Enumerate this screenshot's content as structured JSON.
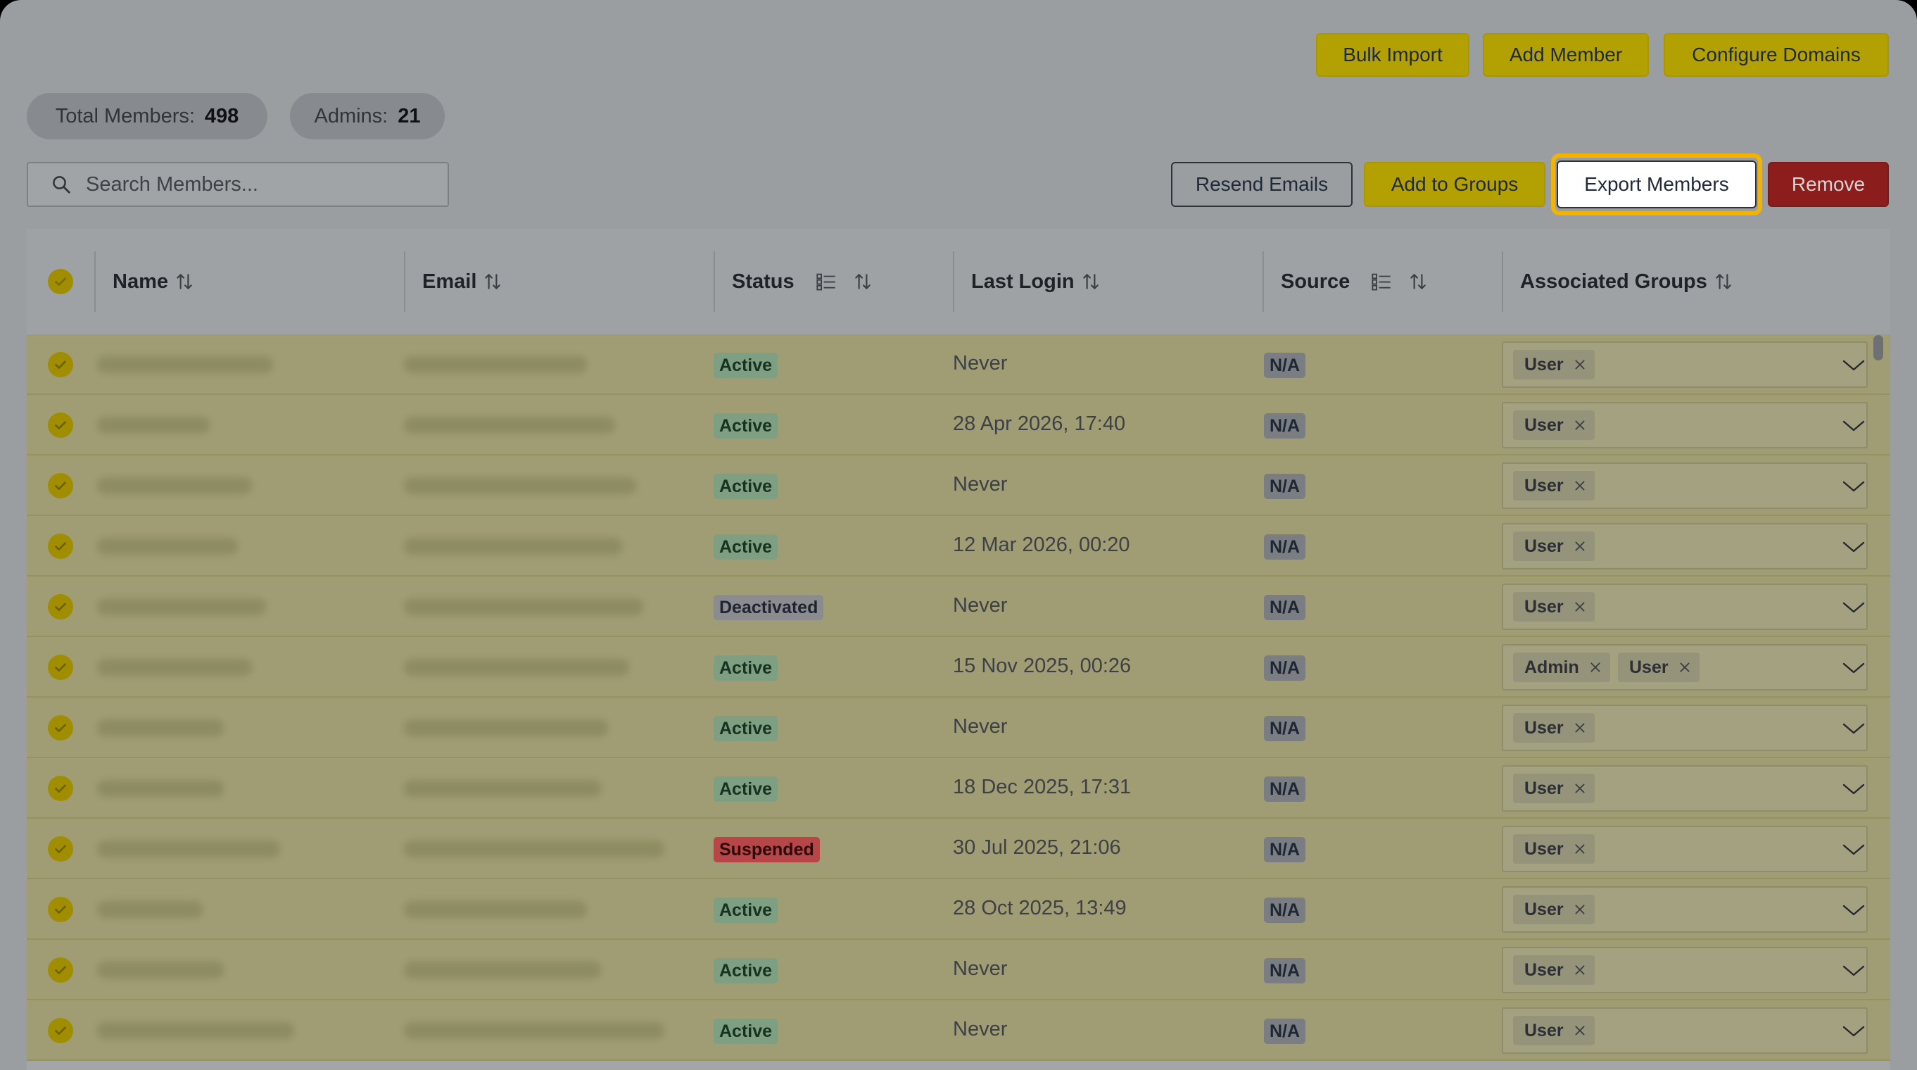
{
  "toolbar": {
    "bulk_import": "Bulk Import",
    "add_member": "Add Member",
    "configure_domains": "Configure Domains"
  },
  "stats": {
    "total_label": "Total Members:",
    "total_value": "498",
    "admins_label": "Admins:",
    "admins_value": "21"
  },
  "search": {
    "placeholder": "Search Members..."
  },
  "actions": {
    "resend_emails": "Resend Emails",
    "add_to_groups": "Add to Groups",
    "export_members": "Export Members",
    "remove": "Remove"
  },
  "table": {
    "headers": {
      "name": "Name",
      "email": "Email",
      "status": "Status",
      "last_login": "Last Login",
      "source": "Source",
      "groups": "Associated Groups"
    },
    "rows": [
      {
        "status": "Active",
        "last_login": "Never",
        "source": "N/A",
        "groups": [
          "User"
        ]
      },
      {
        "status": "Active",
        "last_login": "28 Apr 2026, 17:40",
        "source": "N/A",
        "groups": [
          "User"
        ]
      },
      {
        "status": "Active",
        "last_login": "Never",
        "source": "N/A",
        "groups": [
          "User"
        ]
      },
      {
        "status": "Active",
        "last_login": "12 Mar 2026, 00:20",
        "source": "N/A",
        "groups": [
          "User"
        ]
      },
      {
        "status": "Deactivated",
        "last_login": "Never",
        "source": "N/A",
        "groups": [
          "User"
        ]
      },
      {
        "status": "Active",
        "last_login": "15 Nov 2025, 00:26",
        "source": "N/A",
        "groups": [
          "Admin",
          "User"
        ]
      },
      {
        "status": "Active",
        "last_login": "Never",
        "source": "N/A",
        "groups": [
          "User"
        ]
      },
      {
        "status": "Active",
        "last_login": "18 Dec 2025, 17:31",
        "source": "N/A",
        "groups": [
          "User"
        ]
      },
      {
        "status": "Suspended",
        "last_login": "30 Jul 2025, 21:06",
        "source": "N/A",
        "groups": [
          "User"
        ]
      },
      {
        "status": "Active",
        "last_login": "28 Oct 2025, 13:49",
        "source": "N/A",
        "groups": [
          "User"
        ]
      },
      {
        "status": "Active",
        "last_login": "Never",
        "source": "N/A",
        "groups": [
          "User"
        ]
      },
      {
        "status": "Active",
        "last_login": "Never",
        "source": "N/A",
        "groups": [
          "User"
        ]
      }
    ]
  },
  "colors": {
    "accent_yellow": "#b3a104",
    "focus_ring": "#f2b400",
    "danger": "#8c1d1d",
    "selected_row": "#a09c73"
  },
  "icons": {
    "search": "search-icon",
    "sort": "sort-icon",
    "filter": "filter-list-icon",
    "check": "check-circle-icon",
    "remove_chip": "close-icon",
    "dropdown": "chevron-down-icon"
  }
}
